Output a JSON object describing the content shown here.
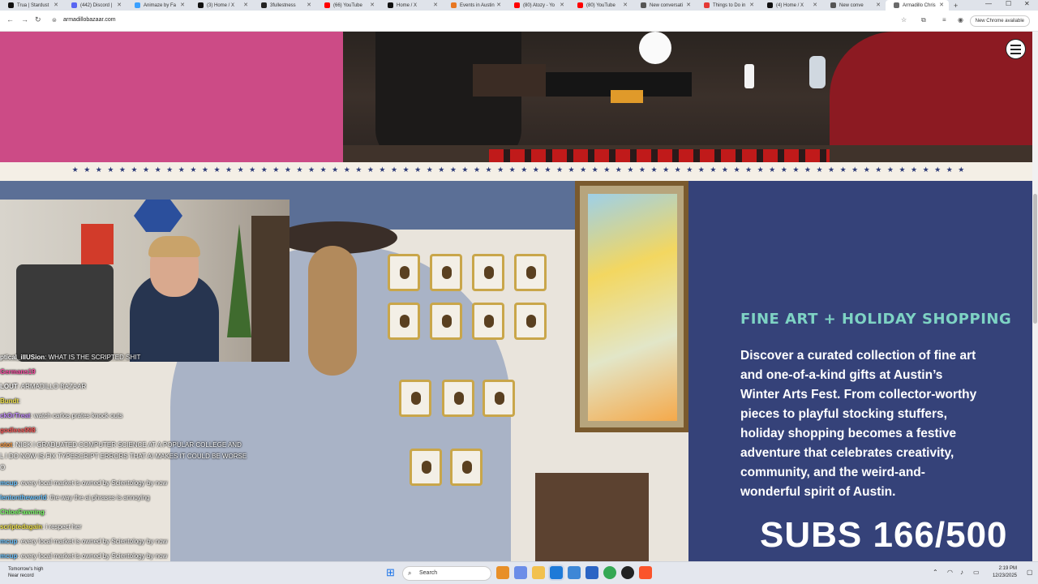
{
  "browser": {
    "tabs": [
      {
        "title": "Trua | Stardust",
        "icon": "x-icon",
        "color": "#111111"
      },
      {
        "title": "(442) Discord |",
        "icon": "discord-icon",
        "color": "#5865f2"
      },
      {
        "title": "Animaze by Fa",
        "icon": "animaze-icon",
        "color": "#3aa0ff"
      },
      {
        "title": "(3) Home / X",
        "icon": "x-icon",
        "color": "#111111"
      },
      {
        "title": "3fullestness",
        "icon": "app-icon",
        "color": "#222222"
      },
      {
        "title": "(66) YouTube",
        "icon": "youtube-icon",
        "color": "#ff0000"
      },
      {
        "title": "Home / X",
        "icon": "x-icon",
        "color": "#111111"
      },
      {
        "title": "Events in Austin",
        "icon": "events-icon",
        "color": "#e87722"
      },
      {
        "title": "(80) Atozy - Yo",
        "icon": "youtube-icon",
        "color": "#ff0000"
      },
      {
        "title": "(80) YouTube",
        "icon": "youtube-icon",
        "color": "#ff0000"
      },
      {
        "title": "New conversati",
        "icon": "chat-icon",
        "color": "#555555"
      },
      {
        "title": "Things to Do in",
        "icon": "map-pin-icon",
        "color": "#e53935"
      },
      {
        "title": "(4) Home / X",
        "icon": "x-icon",
        "color": "#111111"
      },
      {
        "title": "New conve",
        "icon": "chat-icon",
        "color": "#555555"
      },
      {
        "title": "Armadillo Chris",
        "icon": "armadillo-icon",
        "color": "#6b6b6b",
        "active": true
      }
    ],
    "url": "armadillobazaar.com",
    "new_chrome_label": "New Chrome available"
  },
  "page": {
    "stars": "★ ★ ★ ★ ★ ★ ★ ★ ★ ★ ★ ★ ★ ★ ★ ★ ★ ★ ★ ★ ★ ★ ★ ★ ★ ★ ★ ★ ★ ★ ★ ★ ★ ★ ★ ★ ★ ★ ★ ★ ★ ★ ★ ★ ★ ★ ★ ★ ★ ★ ★ ★ ★ ★ ★ ★ ★ ★ ★ ★ ★ ★ ★ ★ ★ ★ ★ ★ ★ ★ ★ ★ ★ ★ ★ ★",
    "section_heading": "FINE ART + HOLIDAY SHOPPING",
    "section_body": "Discover a curated collection of fine art and one-of-a-kind gifts at Austin’s Winter Arts Fest. From collector-worthy pieces to playful stocking stuffers, holiday shopping becomes a festive adventure that celebrates creativity, community, and the weird-and-wonderful spirit of Austin.",
    "colors": {
      "pink": "#cc4b86",
      "navy": "#354279",
      "teal_heading": "#7ed3c4",
      "cream": "#f4efe6"
    }
  },
  "stream": {
    "subs_counter": "SUBS 166/500",
    "chat": [
      {
        "user": "ptical_illUSion",
        "user_color": "#ffffff",
        "message": ": WHAT IS THE SCRIPTED SHIT"
      },
      {
        "user": "Germans19",
        "user_color": "#ff4da6",
        "message": ""
      },
      {
        "user": "LOUT",
        "user_color": "#ffffff",
        "message": ": ARMADILLO BAZAAR"
      },
      {
        "user": "Bundt",
        "user_color": "#f2e44c",
        "message": ":"
      },
      {
        "user": "ckOrTreat",
        "user_color": "#c48cff",
        "message": ": watch carlos prates knock outs"
      },
      {
        "user": "godless998",
        "user_color": "#ff5a5a",
        "message": ":"
      },
      {
        "user": "otot",
        "user_color": "#ff9a3c",
        "message": ": NICK I GRADUATED COMPUTER SCIENCE AT A POPULAR COLLEGE AND"
      },
      {
        "user": "",
        "user_color": "#ffffff",
        "message": "L I DO NOW IS FIX TYPESCRIPT ERRORS THAT AI MAKES IT COULD BE WORSE"
      },
      {
        "user": "",
        "user_color": "#ffffff",
        "message": "O"
      },
      {
        "user": "mcup",
        "user_color": "#6cc4ff",
        "message": ": every local market is owned by Scientology by now"
      },
      {
        "user": "lentontheworld",
        "user_color": "#6cc4ff",
        "message": ": the way the ai phrases is annoying"
      },
      {
        "user": "ChloeFawning",
        "user_color": "#7dff6b",
        "message": ":"
      },
      {
        "user": "scriptedagain",
        "user_color": "#f2e44c",
        "message": ":  i respect her"
      },
      {
        "user": "mcup",
        "user_color": "#6cc4ff",
        "message": ": every local market is owned by Scientology by now"
      },
      {
        "user": "mcup",
        "user_color": "#6cc4ff",
        "message": ": every local market is owned by Scientology by now"
      }
    ]
  },
  "taskbar": {
    "weather_line1": "Tomorrow's high",
    "weather_line2": "Near record",
    "search_placeholder": "Search",
    "time": "2:19 PM",
    "date": "12/23/2025"
  }
}
